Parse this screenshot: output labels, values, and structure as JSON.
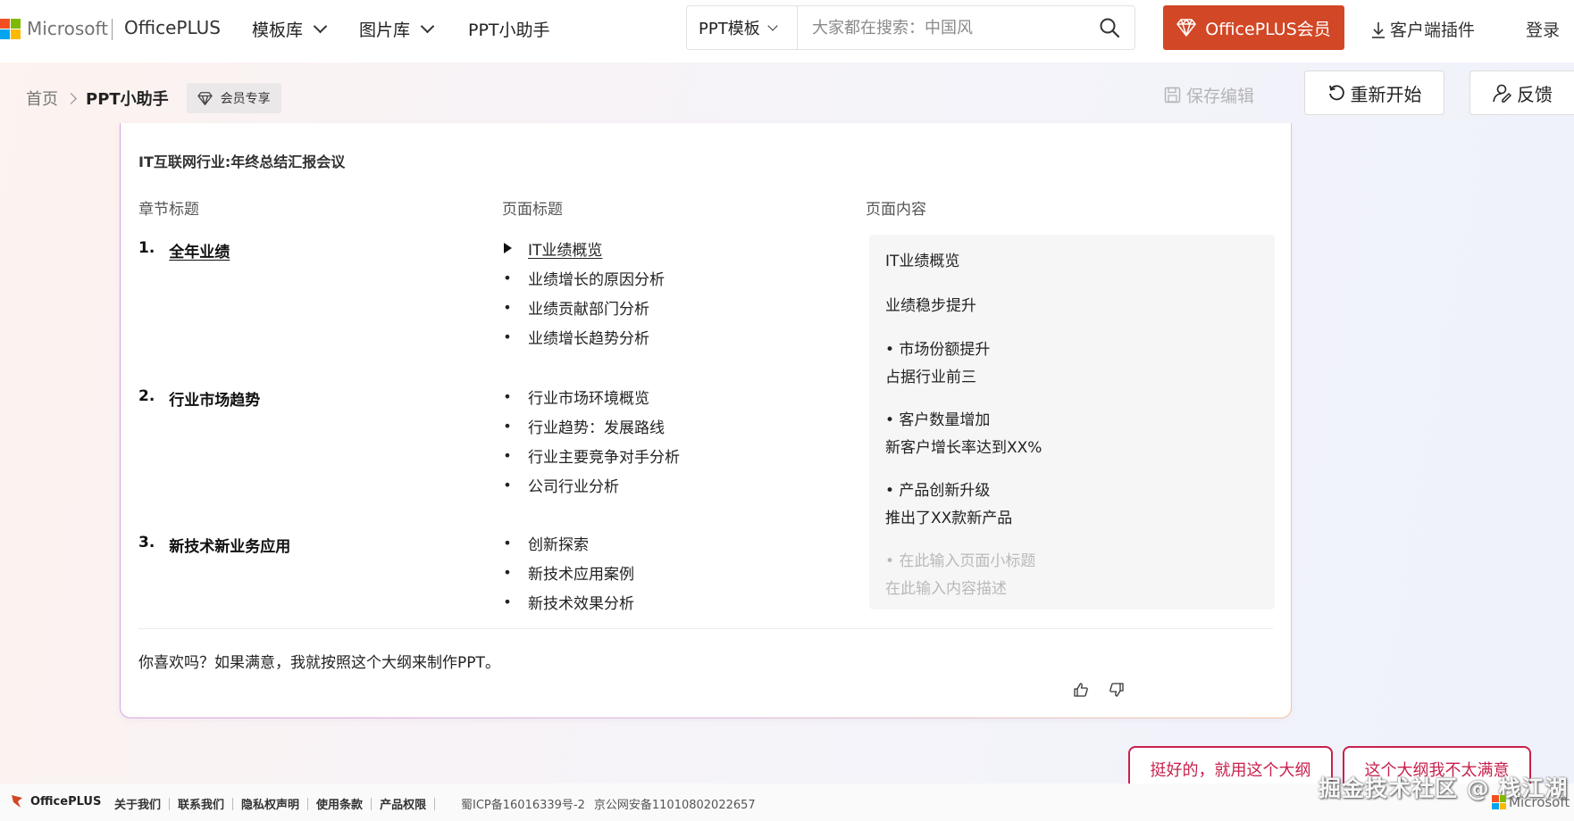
{
  "header": {
    "ms_brand": "Microsoft",
    "site_brand": "OfficePLUS",
    "nav": [
      {
        "label": "模板库"
      },
      {
        "label": "图片库"
      },
      {
        "label": "PPT小助手"
      }
    ],
    "search": {
      "type": "PPT模板",
      "placeholder": "大家都在搜索：中国风"
    },
    "vip_label": "OfficePLUS会员",
    "plugin_label": "客户端插件",
    "login_label": "登录",
    "colors": {
      "vip": "#d24726",
      "accent": "#c7214c"
    }
  },
  "breadcrumb": {
    "home": "首页",
    "current": "PPT小助手",
    "badge": "会员专享"
  },
  "toolbar": {
    "save_label": "保存编辑",
    "restart_label": "重新开始",
    "feedback_label": "反馈"
  },
  "outline": {
    "title": "IT互联网行业:年终总结汇报会议",
    "col_chapter": "章节标题",
    "col_page": "页面标题",
    "col_content": "页面内容",
    "chapters": [
      {
        "num": "1.",
        "title": "全年业绩",
        "pages": [
          "IT业绩概览",
          "业绩增长的原因分析",
          "业绩贡献部门分析",
          "业绩增长趋势分析"
        ]
      },
      {
        "num": "2.",
        "title": "行业市场趋势",
        "pages": [
          "行业市场环境概览",
          "行业趋势：发展路线",
          "行业主要竞争对手分析",
          "公司行业分析"
        ]
      },
      {
        "num": "3.",
        "title": "新技术新业务应用",
        "pages": [
          "创新探索",
          "新技术应用案例",
          "新技术效果分析"
        ]
      }
    ],
    "bullet": "•",
    "content": {
      "title": "IT业绩概览",
      "subtitle": "业绩稳步提升",
      "points": [
        {
          "point": "• 市场份额提升",
          "desc": "占据行业前三"
        },
        {
          "point": "• 客户数量增加",
          "desc": "新客户增长率达到XX%"
        },
        {
          "point": "• 产品创新升级",
          "desc": "推出了XX款新产品"
        },
        {
          "point": "• 在此输入页面小标题",
          "desc": "在此输入内容描述"
        }
      ]
    },
    "prompt": "你喜欢吗？如果满意，我就按照这个大纲来制作PPT。"
  },
  "actions": {
    "good": "挺好的，就用这个大纲",
    "bad": "这个大纲我不太满意"
  },
  "footer": {
    "brand": "OfficePLUS",
    "links": [
      "关于我们",
      "联系我们",
      "隐私权声明",
      "使用条款",
      "产品权限"
    ],
    "icp": "蜀ICP备16016339号-2",
    "police": "京公网安备11010802022657",
    "watermark": "掘金技术社区 @ 栈江湖",
    "ms_brand": "Microsoft"
  }
}
